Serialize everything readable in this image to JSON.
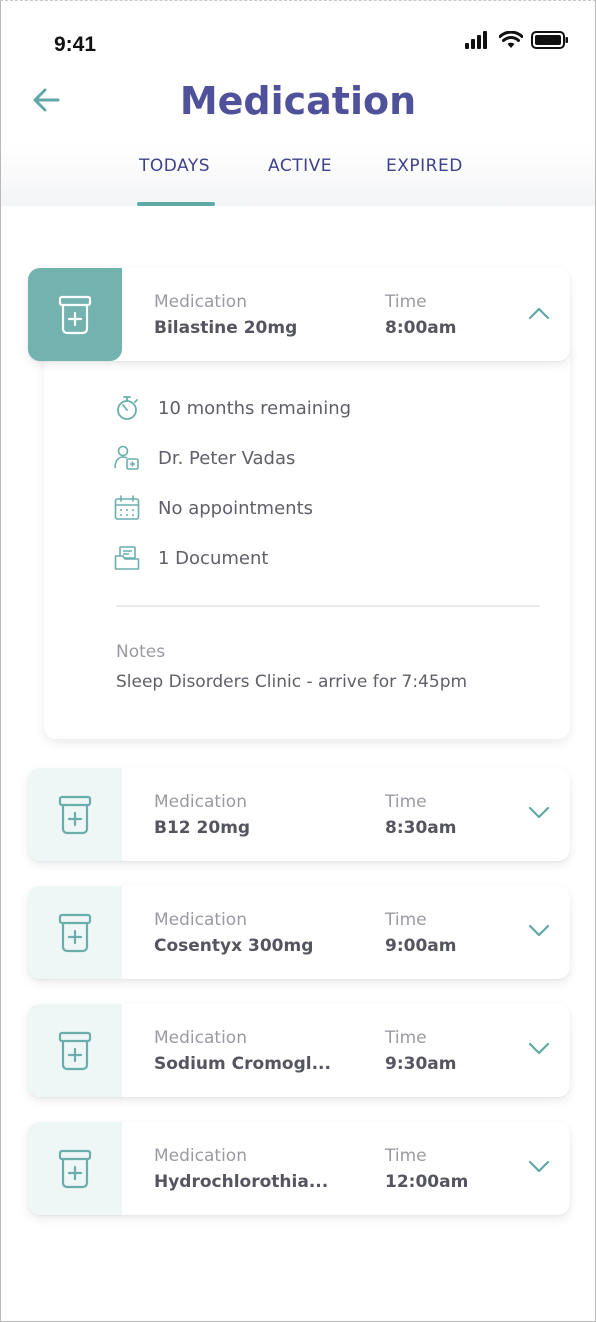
{
  "status_bar": {
    "time": "9:41"
  },
  "header": {
    "title": "Medication"
  },
  "tabs": [
    {
      "label": "TODAYS"
    },
    {
      "label": "ACTIVE"
    },
    {
      "label": "EXPIRED"
    }
  ],
  "colors": {
    "accent": "#72b3b0",
    "title": "#4f519a",
    "tab": "#3f418c"
  },
  "medications": [
    {
      "med_label": "Medication",
      "name": "Bilastine 20mg",
      "time_label": "Time",
      "time": "8:00am"
    },
    {
      "med_label": "Medication",
      "name": "B12 20mg",
      "time_label": "Time",
      "time": "8:30am"
    },
    {
      "med_label": "Medication",
      "name": "Cosentyx 300mg",
      "time_label": "Time",
      "time": "9:00am"
    },
    {
      "med_label": "Medication",
      "name": "Sodium Cromogl...",
      "time_label": "Time",
      "time": "9:30am"
    },
    {
      "med_label": "Medication",
      "name": "Hydrochlorothia...",
      "time_label": "Time",
      "time": "12:00am"
    }
  ],
  "details": {
    "remaining": "10 months remaining",
    "doctor": "Dr. Peter Vadas",
    "appointments": "No appointments",
    "documents": "1 Document",
    "notes_label": "Notes",
    "notes": "Sleep Disorders Clinic - arrive for 7:45pm"
  },
  "icons": {
    "back": "arrow-left-icon",
    "med": "pill-bottle-icon",
    "timer": "stopwatch-icon",
    "doctor": "doctor-icon",
    "calendar": "calendar-icon",
    "document": "folder-document-icon",
    "chevron_up": "chevron-up-icon",
    "chevron_down": "chevron-down-icon"
  }
}
